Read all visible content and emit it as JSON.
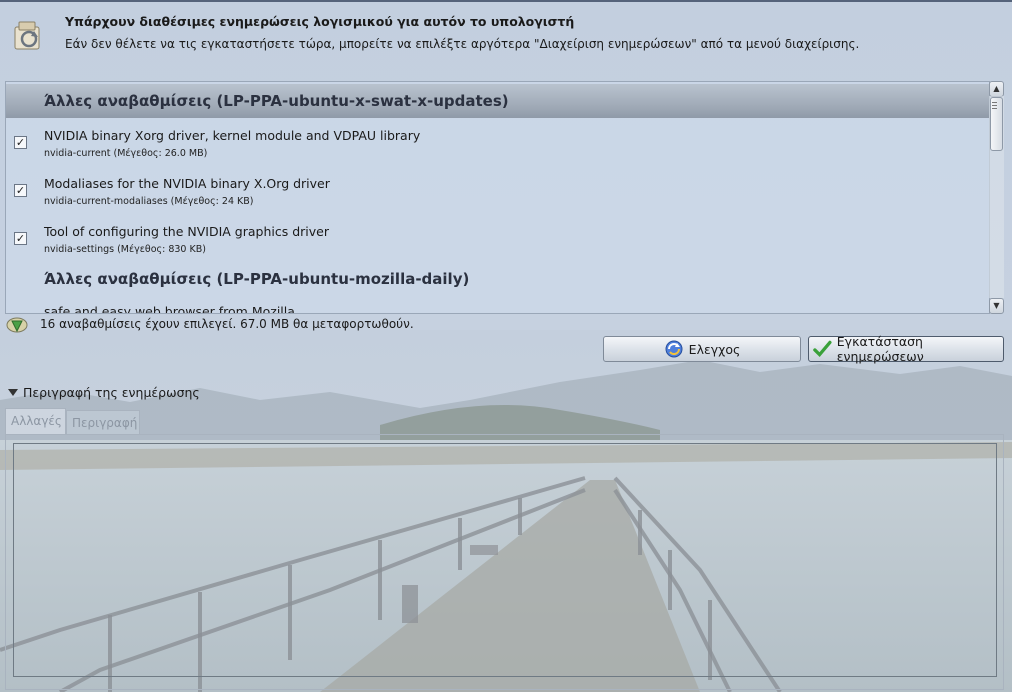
{
  "header": {
    "title": "Υπάρχουν διαθέσιμες ενημερώσεις λογισμικού για αυτόν το υπολογιστή",
    "text": "Εάν δεν θέλετε να τις εγκαταστήσετε τώρα, μπορείτε να επιλέξτε αργότερα \"Διαχείριση ενημερώσεων\" από τα μενού διαχείρισης.",
    "icon": "software-update-icon"
  },
  "list": {
    "groups": [
      {
        "label": "Άλλες αναβαθμίσεις (LP-PPA-ubuntu-x-swat-x-updates)"
      },
      {
        "label": "Άλλες αναβαθμίσεις (LP-PPA-ubuntu-mozilla-daily)"
      }
    ],
    "items": [
      {
        "title": "NVIDIA binary Xorg driver, kernel module and VDPAU library",
        "subtitle": "nvidia-current (Μέγεθος: 26.0 MB)",
        "checked": true,
        "check_glyph": "✓"
      },
      {
        "title": "Modaliases for the NVIDIA binary X.Org driver",
        "subtitle": "nvidia-current-modaliases (Μέγεθος: 24 KB)",
        "checked": true,
        "check_glyph": "✓"
      },
      {
        "title": "Tool of configuring the NVIDIA graphics driver",
        "subtitle": "nvidia-settings (Μέγεθος: 830 KB)",
        "checked": true,
        "check_glyph": "✓"
      },
      {
        "title": "safe and easy web browser from Mozilla",
        "subtitle": ""
      }
    ]
  },
  "status": {
    "text": "16 αναβαθμίσεις έχουν επιλεγεί. 67.0 MB θα μεταφορτωθούν.",
    "icon": "download-arrow-icon"
  },
  "buttons": {
    "check": {
      "label": "Ελεγχος",
      "icon": "refresh-icon"
    },
    "install": {
      "label": "Εγκατάσταση ενημερώσεων",
      "icon": "checkmark-icon"
    }
  },
  "description": {
    "toggle_label": "Περιγραφή της ενημέρωσης",
    "tabs": [
      {
        "label": "Αλλαγές",
        "active": true
      },
      {
        "label": "Περιγραφή",
        "active": false
      }
    ]
  },
  "colors": {
    "window_tint": "#c3cfdf",
    "group_header": "#9ea8b5",
    "install_check": "#3aa13a",
    "refresh_blue": "#2e5fc1"
  }
}
